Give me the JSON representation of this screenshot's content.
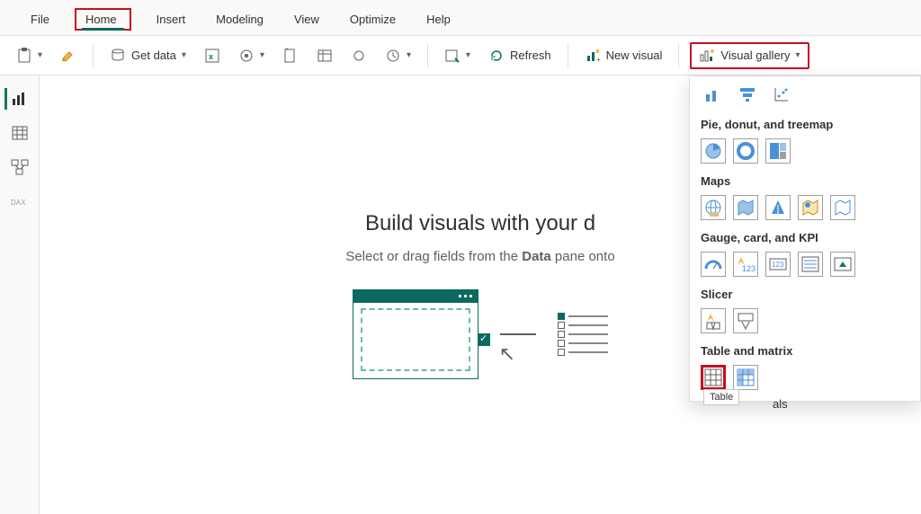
{
  "menubar": {
    "items": [
      {
        "label": "File"
      },
      {
        "label": "Home",
        "active": true
      },
      {
        "label": "Insert"
      },
      {
        "label": "Modeling"
      },
      {
        "label": "View"
      },
      {
        "label": "Optimize"
      },
      {
        "label": "Help"
      }
    ]
  },
  "ribbon": {
    "get_data": "Get data",
    "refresh": "Refresh",
    "new_visual": "New visual",
    "visual_gallery": "Visual gallery"
  },
  "leftrail": {
    "items": [
      {
        "name": "report-view",
        "active": true
      },
      {
        "name": "table-view"
      },
      {
        "name": "model-view"
      },
      {
        "name": "dax-view"
      }
    ]
  },
  "canvas": {
    "title": "Build visuals with your d",
    "subtitle_pre": "Select or drag fields from the ",
    "subtitle_bold": "Data",
    "subtitle_post": " pane onto"
  },
  "gallery": {
    "sections": [
      {
        "label": "Pie, donut, and treemap",
        "icons": [
          "pie",
          "donut",
          "treemap"
        ]
      },
      {
        "label": "Maps",
        "icons": [
          "map",
          "filled-map",
          "azure-map",
          "arcgis-map",
          "shape-map"
        ]
      },
      {
        "label": "Gauge, card, and KPI",
        "icons": [
          "gauge",
          "card-new",
          "card",
          "multi-row-card",
          "kpi"
        ]
      },
      {
        "label": "Slicer",
        "icons": [
          "slicer-new",
          "slicer"
        ]
      },
      {
        "label": "Table and matrix",
        "icons": [
          "table",
          "matrix"
        ]
      }
    ],
    "tooltip": "Table",
    "last_label_partial": "als"
  }
}
